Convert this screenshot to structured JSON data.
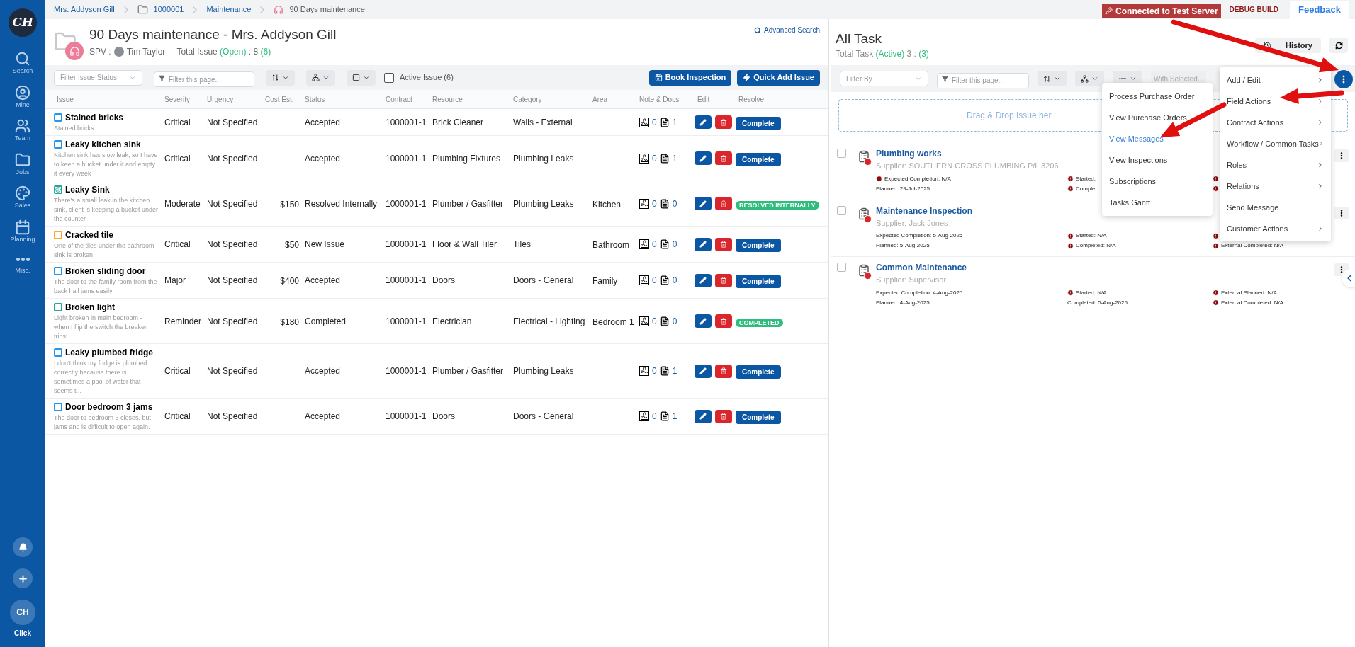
{
  "sidebar": {
    "logo": "CH",
    "items": [
      {
        "label": "Search",
        "kind": "search"
      },
      {
        "label": "Mine",
        "kind": "user"
      },
      {
        "label": "Team",
        "kind": "team"
      },
      {
        "label": "Jobs",
        "kind": "folder"
      },
      {
        "label": "Sales",
        "kind": "swatch"
      },
      {
        "label": "Planning",
        "kind": "calendar"
      },
      {
        "label": "Misc.",
        "kind": "dots"
      }
    ],
    "avatar": "CH",
    "avatar_label": "Click"
  },
  "breadcrumb": [
    {
      "label": "Mrs. Addyson Gill",
      "kind": "link"
    },
    {
      "label": "1000001",
      "kind": "folder"
    },
    {
      "label": "Maintenance",
      "kind": "link"
    },
    {
      "label": "90 Days maintenance",
      "kind": "current"
    }
  ],
  "top_bar": {
    "server_badge": "Connected to Test Server",
    "build": "DEBUG BUILD",
    "feedback": "Feedback"
  },
  "issues_panel": {
    "title": "90 Days maintenance - Mrs. Addyson Gill",
    "spv_label": "SPV :",
    "spv_name": "Tim Taylor",
    "total_label": "Total Issue",
    "total_state": "(Open)",
    "total_sep": ": 8",
    "total_count": "(6)",
    "advanced_search": "Advanced Search",
    "toolbar": {
      "status_filter": {
        "placeholder": "Filter Issue Status"
      },
      "page_filter": {
        "placeholder": "Filter this page..."
      },
      "active_issue": {
        "label": "Active Issue (6)",
        "checked": false
      },
      "buttons": [
        "Book Inspection",
        "Quick Add Issue"
      ]
    },
    "columns": [
      "Issue",
      "Severity",
      "Urgency",
      "Cost Est.",
      "Status",
      "Contract",
      "Resource",
      "Category",
      "Area",
      "Note & Docs",
      "Edit",
      "Resolve"
    ],
    "rows": [
      {
        "title": "Stained bricks",
        "description": "Stained bricks",
        "color": "#2196f3",
        "kind": "plain",
        "severity": "Critical",
        "urgency": "Not Specified",
        "status": "Accepted",
        "contract": "1000001-1",
        "resource": "Brick Cleaner",
        "category": "Walls - External",
        "notes": "0",
        "docs": "1",
        "docs_flagged": false,
        "resolve": {
          "kind": "button",
          "label": "Complete"
        }
      },
      {
        "title": "Leaky kitchen sink",
        "description": "Kitchen sink has slow leak, so I have to keep a bucket under it and empty it every week",
        "color": "#2196f3",
        "kind": "plain",
        "severity": "Critical",
        "urgency": "Not Specified",
        "status": "Accepted",
        "contract": "1000001-1",
        "resource": "Plumbing Fixtures",
        "category": "Plumbing Leaks",
        "notes": "0",
        "docs": "1",
        "docs_flagged": true,
        "resolve": {
          "kind": "button",
          "label": "Complete"
        }
      },
      {
        "title": "Leaky Sink",
        "description": "There's a small leak in the kitchen sink, client is keeping a bucket under the counter",
        "color": "#26a69a",
        "kind": "info",
        "severity": "Moderate",
        "urgency": "Not Specified",
        "cost": "$150",
        "status": "Resolved Internally",
        "contract": "1000001-1",
        "resource": "Plumber / Gasfitter",
        "category": "Plumbing Leaks",
        "area": "Kitchen",
        "notes": "0",
        "docs": "0",
        "docs_flagged": true,
        "resolve": {
          "kind": "badge",
          "label": "RESOLVED INTERNALLY"
        }
      },
      {
        "title": "Cracked tile",
        "description": "One of the tiles under the bathroom sink is broken",
        "color": "#ffa726",
        "kind": "plain",
        "severity": "Critical",
        "urgency": "Not Specified",
        "cost": "$50",
        "status": "New Issue",
        "contract": "1000001-1",
        "resource": "Floor & Wall Tiler",
        "category": "Tiles",
        "area": "Bathroom",
        "notes": "0",
        "docs": "0",
        "docs_flagged": false,
        "resolve": {
          "kind": "button",
          "label": "Complete"
        }
      },
      {
        "title": "Broken sliding door",
        "description": "The door to the family room from the back hall jams easily",
        "color": "#2196f3",
        "kind": "plain",
        "severity": "Major",
        "urgency": "Not Specified",
        "cost": "$400",
        "status": "Accepted",
        "contract": "1000001-1",
        "resource": "Doors",
        "category": "Doors - General",
        "area": "Family",
        "notes": "0",
        "docs": "0",
        "docs_flagged": false,
        "resolve": {
          "kind": "button",
          "label": "Complete"
        }
      },
      {
        "title": "Broken light",
        "description": "Light broken in main bedroom - when I flip the switch the breaker trips!",
        "color": "#26a69a",
        "kind": "plain",
        "severity": "Reminder",
        "urgency": "Not Specified",
        "cost": "$180",
        "status": "Completed",
        "contract": "1000001-1",
        "resource": "Electrician",
        "category": "Electrical - Lighting",
        "area": "Bedroom 1",
        "notes": "0",
        "docs": "0",
        "docs_flagged": true,
        "resolve": {
          "kind": "badge",
          "label": "COMPLETED"
        }
      },
      {
        "title": "Leaky plumbed fridge",
        "description": "I don't think my fridge is plumbed correctly because there is sometimes a pool of water that seems t...",
        "color": "#2196f3",
        "kind": "plain",
        "severity": "Critical",
        "urgency": "Not Specified",
        "status": "Accepted",
        "contract": "1000001-1",
        "resource": "Plumber / Gasfitter",
        "category": "Plumbing Leaks",
        "notes": "0",
        "docs": "1",
        "docs_flagged": true,
        "resolve": {
          "kind": "button",
          "label": "Complete"
        }
      },
      {
        "title": "Door bedroom 3 jams",
        "description": "The door to bedroom 3 closes, but jams and is difficult to open again.",
        "color": "#2196f3",
        "kind": "plain",
        "severity": "Critical",
        "urgency": "Not Specified",
        "status": "Accepted",
        "contract": "1000001-1",
        "resource": "Doors",
        "category": "Doors - General",
        "notes": "0",
        "docs": "1",
        "docs_flagged": false,
        "resolve": {
          "kind": "button",
          "label": "Complete"
        }
      }
    ]
  },
  "tasks_panel": {
    "title": "All Task",
    "total_label": "Total Task",
    "total_state": "(Active)",
    "total_sep": "3 :",
    "total_count": "(3)",
    "history_button": "History",
    "toolbar": {
      "filter_by": {
        "placeholder": "Filter By"
      },
      "page_filter": {
        "placeholder": "Filter this page..."
      },
      "with_selected": "With Selected..."
    },
    "drop_zone": "Drag & Drop Issue her",
    "tasks": [
      {
        "title": "Plumbing works",
        "supplier": "Supplier: SOUTHERN CROSS PLUMBING P/L 3206",
        "checked": false,
        "details": [
          [
            {
              "text": "Expected Completion: N/A",
              "alert": true
            },
            {
              "text": "Planned: 29-Jul-2025",
              "alert": false
            }
          ],
          [
            {
              "text": "Started:",
              "alert": true
            },
            {
              "text": "Complet",
              "alert": true
            }
          ],
          [
            {
              "alert": true
            },
            {
              "alert": true
            }
          ]
        ]
      },
      {
        "title": "Maintenance Inspection",
        "supplier": "Supplier: Jack Jones",
        "checked": false,
        "details": [
          [
            {
              "text": "Expected Completion: 5-Aug-2025",
              "alert": false
            },
            {
              "text": "Planned: 5-Aug-2025",
              "alert": false
            }
          ],
          [
            {
              "text": "Started: N/A",
              "alert": true
            },
            {
              "text": "Completed: N/A",
              "alert": true
            }
          ],
          [
            {
              "alert": true
            },
            {
              "text": "External Completed: N/A",
              "alert": true
            }
          ]
        ]
      },
      {
        "title": "Common Maintenance",
        "supplier": "Supplier: Supervisor",
        "checked": false,
        "details": [
          [
            {
              "text": "Expected Completion: 4-Aug-2025",
              "alert": false
            },
            {
              "text": "Planned: 4-Aug-2025",
              "alert": false
            }
          ],
          [
            {
              "text": "Started: N/A",
              "alert": true
            },
            {
              "text": "Completed: 5-Aug-2025",
              "alert": false
            }
          ],
          [
            {
              "text": "External Planned: N/A",
              "alert": true
            },
            {
              "text": "External Completed: N/A",
              "alert": true
            }
          ]
        ]
      }
    ]
  },
  "list_menu": [
    {
      "label": "Process Purchase Order",
      "selected": false
    },
    {
      "label": "View Purchase Orders",
      "selected": false
    },
    {
      "label": "View Messages",
      "selected": true
    },
    {
      "label": "View Inspections",
      "selected": false
    },
    {
      "label": "Subscriptions",
      "selected": false
    },
    {
      "label": "Tasks Gantt",
      "selected": false
    }
  ],
  "actions_menu": [
    {
      "label": "Add / Edit",
      "submenu": true
    },
    {
      "label": "Field Actions",
      "submenu": true
    },
    {
      "label": "Contract Actions",
      "submenu": true
    },
    {
      "label": "Workflow / Common Tasks",
      "submenu": true
    },
    {
      "label": "Roles",
      "submenu": true
    },
    {
      "label": "Relations",
      "submenu": true
    },
    {
      "label": "Send Message",
      "submenu": false
    },
    {
      "label": "Customer Actions",
      "submenu": true
    }
  ]
}
